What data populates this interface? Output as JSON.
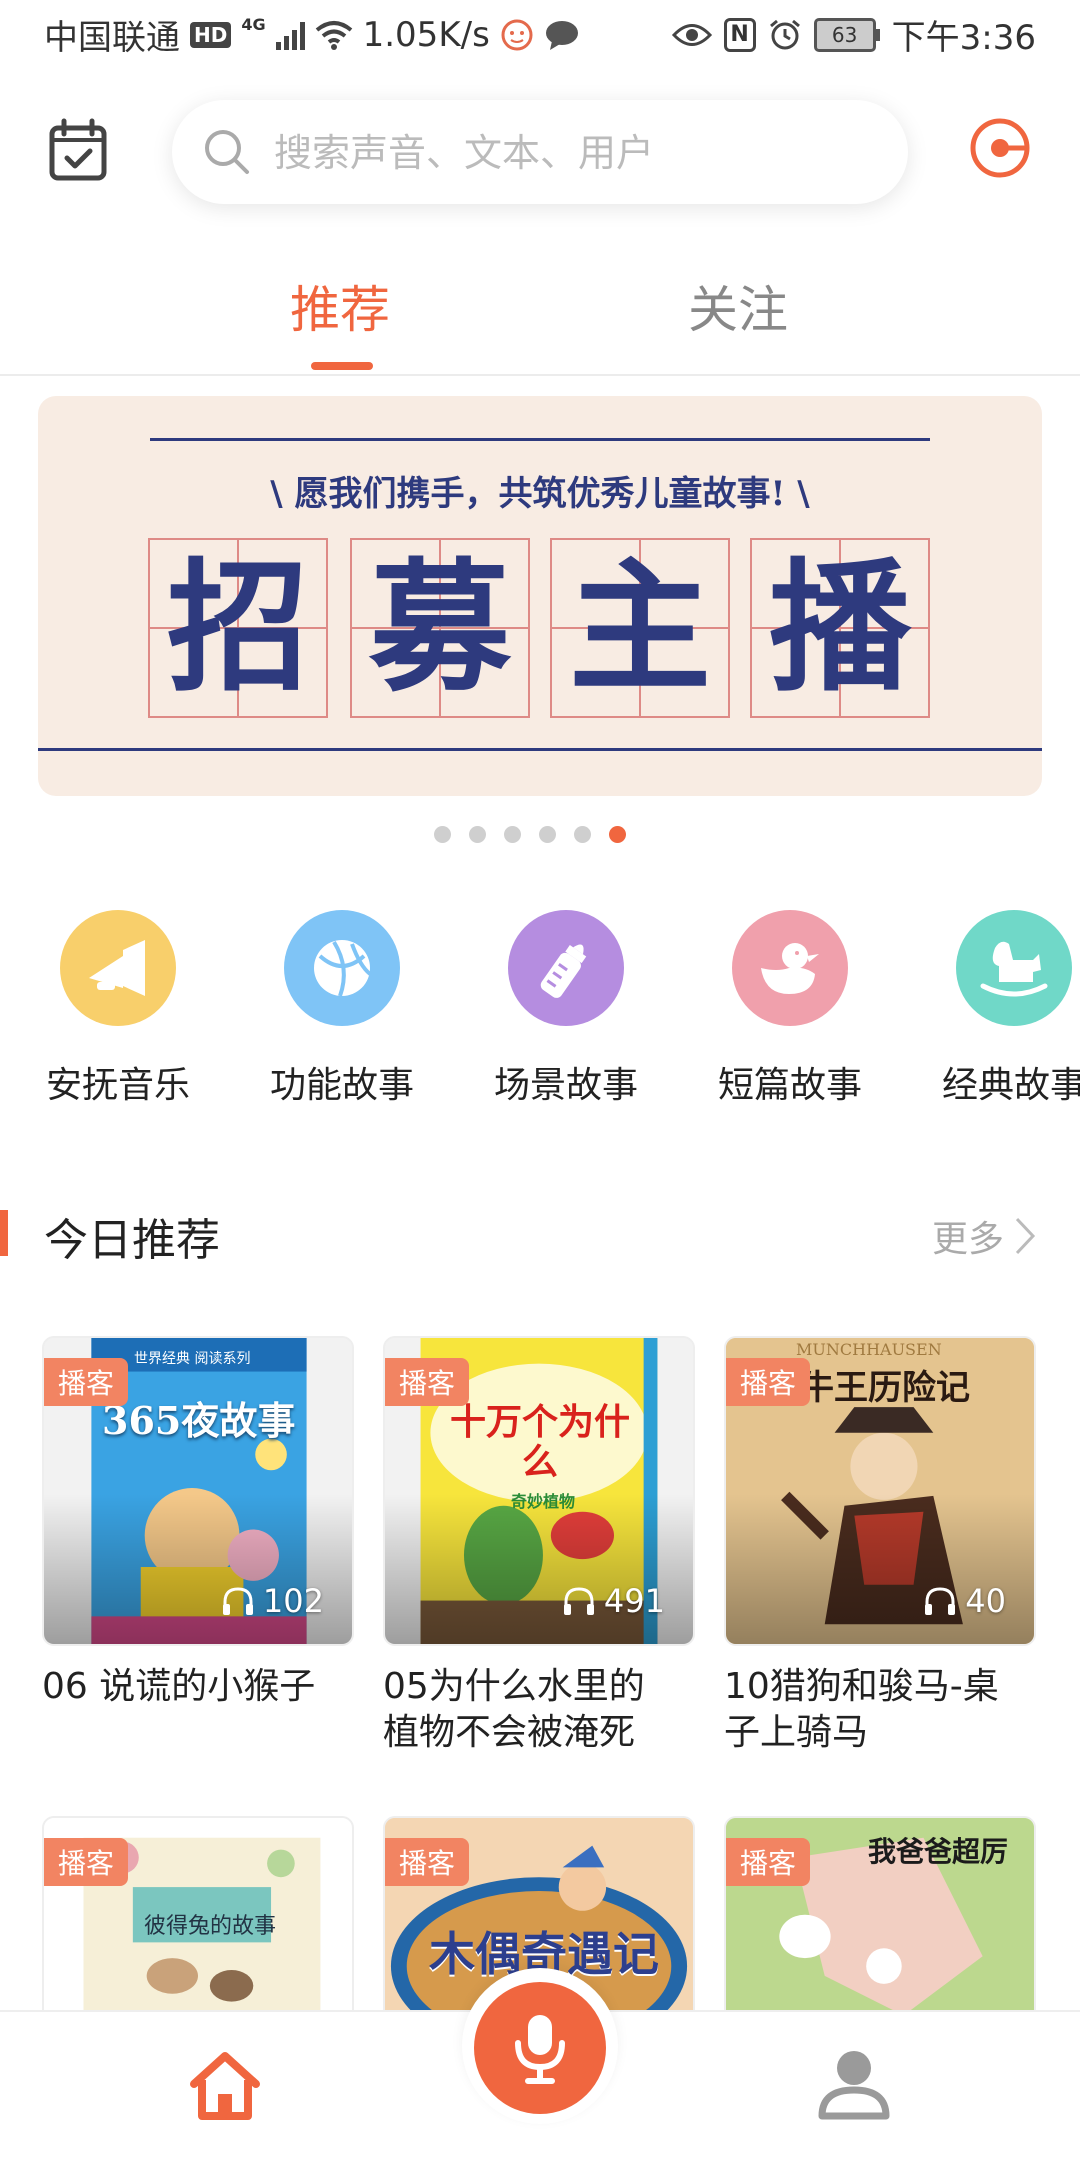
{
  "status_bar": {
    "carrier": "中国联通",
    "hd": "HD",
    "network": "4G",
    "speed": "1.05K/s",
    "nfc": "N",
    "battery": "63",
    "time": "下午3:36"
  },
  "header": {
    "search_placeholder": "搜索声音、文本、用户"
  },
  "tabs": [
    {
      "label": "推荐",
      "active": true
    },
    {
      "label": "关注",
      "active": false
    }
  ],
  "banner": {
    "subtitle": "\\ 愿我们携手，共筑优秀儿童故事! \\",
    "chars": [
      "招",
      "募",
      "主",
      "播"
    ],
    "dots": 6,
    "active_dot": 5
  },
  "categories": [
    {
      "label": "安抚音乐",
      "icon": "trumpet-icon",
      "color": "#f8cf6b"
    },
    {
      "label": "功能故事",
      "icon": "ball-icon",
      "color": "#7fc4f6"
    },
    {
      "label": "场景故事",
      "icon": "baby-bottle-icon",
      "color": "#b58de0"
    },
    {
      "label": "短篇故事",
      "icon": "duck-icon",
      "color": "#f0a0ac"
    },
    {
      "label": "经典故事",
      "icon": "rocking-horse-icon",
      "color": "#70d8c8"
    }
  ],
  "section": {
    "title": "今日推荐",
    "more": "更多"
  },
  "cards": [
    {
      "badge": "播客",
      "plays": "102",
      "title_line1": "06 说谎的小猴子",
      "title_line2": "",
      "cover_text": "365夜故事",
      "cover_top_text": "世界经典    阅读系列"
    },
    {
      "badge": "播客",
      "plays": "491",
      "title_line1": "05为什么水里的",
      "title_line2": "植物不会被淹死",
      "cover_text": "十万个为什么",
      "cover_top_text": "奇妙植物"
    },
    {
      "badge": "播客",
      "plays": "40",
      "title_line1": "10猎狗和骏马-桌",
      "title_line2": "子上骑马",
      "cover_text": "吹牛王历险记",
      "cover_top_text": "MUNCHHAUSEN"
    },
    {
      "badge": "播客",
      "plays": "",
      "title_line1": "",
      "title_line2": "",
      "cover_text": "彼得兔的故事",
      "cover_top_text": ""
    },
    {
      "badge": "播客",
      "plays": "",
      "title_line1": "",
      "title_line2": "",
      "cover_text": "木偶奇遇记",
      "cover_top_text": ""
    },
    {
      "badge": "播客",
      "plays": "",
      "title_line1": "",
      "title_line2": "",
      "cover_text": "我爸爸超厉",
      "cover_top_text": ""
    }
  ],
  "colors": {
    "accent": "#f0663f",
    "banner_blue": "#2e3a7e"
  }
}
